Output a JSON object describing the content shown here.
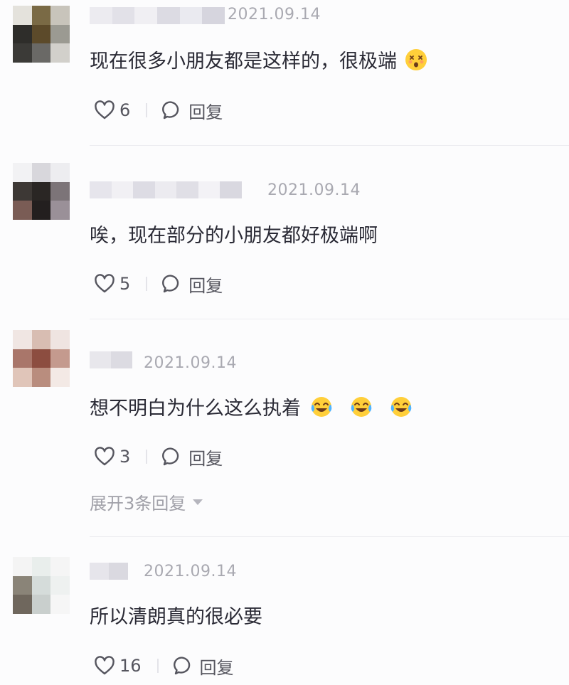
{
  "comments": [
    {
      "date": "2021.09.14",
      "text": "现在很多小朋友都是这样的，很极端",
      "emoji": "dizzy-face-emoji",
      "likes": "6",
      "reply_label": "回复"
    },
    {
      "date": "2021.09.14",
      "text": "唉，现在部分的小朋友都好极端啊",
      "likes": "5",
      "reply_label": "回复"
    },
    {
      "date": "2021.09.14",
      "text": "想不明白为什么这么执着",
      "emoji": "crying-laughing-face-emoji",
      "likes": "3",
      "reply_label": "回复",
      "expand_label": "展开3条回复"
    },
    {
      "date": "2021.09.14",
      "text": "所以清朗真的很必要",
      "likes": "16",
      "reply_label": "回复"
    }
  ],
  "colors": {
    "text": "#2a2a35",
    "muted": "#a9a9b1",
    "icon": "#55555e"
  }
}
